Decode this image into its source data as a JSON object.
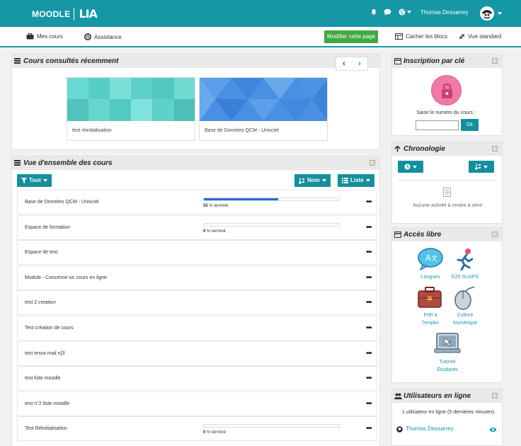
{
  "topbar": {
    "logo_text": "MOODLE",
    "logo_suffix": "LIA",
    "user_name": "Thomas Dessarrey"
  },
  "subnav": {
    "my_courses": "Mes cours",
    "assistance": "Assistance",
    "edit_page": "Modifier cette page",
    "hide_blocks": "Cacher les blocs",
    "standard_view": "Vue standard"
  },
  "recent": {
    "title": "Cours consultés récemment",
    "cards": [
      {
        "name": "test réinitialisation"
      },
      {
        "name": "Base de Données QCM - Unisciel"
      }
    ]
  },
  "overview": {
    "title": "Vue d'ensemble des cours",
    "filter_label": "Tout",
    "sort_label": "Nom",
    "view_label": "Liste",
    "courses": [
      {
        "name": "Base de Données QCM - Unisciel",
        "progress": 55,
        "progress_text": "55",
        "suffix": " % terminé"
      },
      {
        "name": "Espace de formation",
        "progress": 0,
        "progress_text": "0",
        "suffix": " % terminé"
      },
      {
        "name": "Espace de test"
      },
      {
        "name": "Module - Concevoir un cours en ligne"
      },
      {
        "name": "test 2 creation"
      },
      {
        "name": "Test création de cours"
      },
      {
        "name": "test envoi mail n[3"
      },
      {
        "name": "test liste moodle"
      },
      {
        "name": "test n°2 liste moodle"
      },
      {
        "name": "Test Réinitialisation",
        "progress": 0,
        "progress_text": "0",
        "suffix": " % terminé"
      }
    ]
  },
  "enrol": {
    "title": "Inscription par clé",
    "label": "Saisir le numéro du cours :",
    "ok": "Ok"
  },
  "chrono": {
    "title": "Chronologie",
    "empty": "Aucune activité à rendre à venir"
  },
  "access": {
    "title": "Accès libre",
    "items": [
      {
        "label": "Langues"
      },
      {
        "label": "E20 SUAPS"
      },
      {
        "label": "Prêt à l'emploi"
      },
      {
        "label": "Culture Numérique"
      },
      {
        "label": "Tutoriel Étudiants"
      }
    ]
  },
  "online": {
    "title": "Utilisateurs en ligne",
    "text": "1 utilisateur en ligne (5 dernières minutes)",
    "user": "Thomas Dessarrey"
  },
  "colors": {
    "brand": "#1597a6",
    "green": "#42a842",
    "progress": "#1e6fd0"
  }
}
